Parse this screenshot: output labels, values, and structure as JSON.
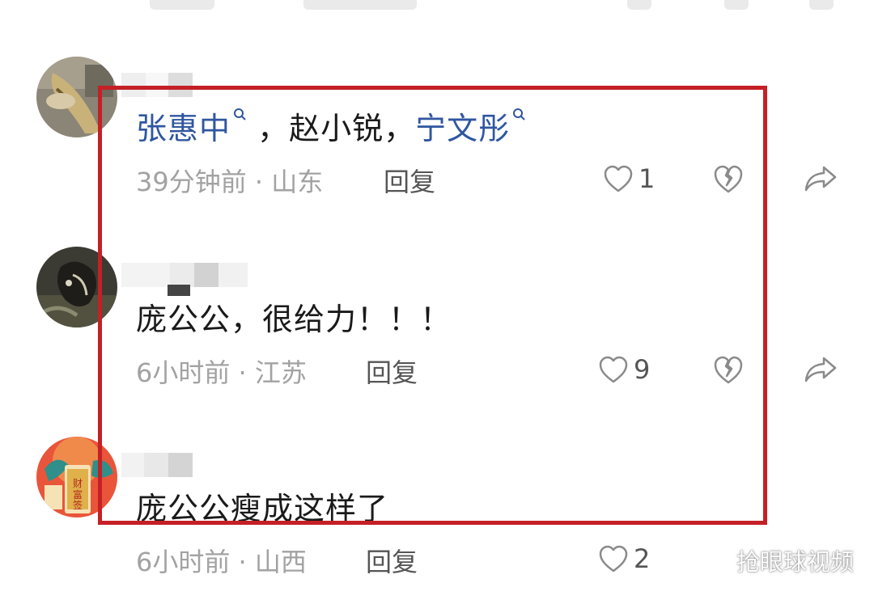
{
  "comments": [
    {
      "segments": [
        {
          "text": "张惠中",
          "type": "mention"
        },
        {
          "text": "，赵小锐，",
          "type": "plain"
        },
        {
          "text": "宁文彤",
          "type": "mention"
        }
      ],
      "meta": "39分钟前 · 山东",
      "reply_label": "回复",
      "likes": "1"
    },
    {
      "text": "庞公公，很给力！！！",
      "meta": "6小时前 · 江苏",
      "reply_label": "回复",
      "likes": "9"
    },
    {
      "text": "庞公公瘦成这样了",
      "meta": "6小时前 · 山西",
      "reply_label": "回复",
      "likes": "2"
    }
  ],
  "watermark": "抢眼球视频",
  "icons": {
    "mention": "search-icon",
    "like": "heart-outline-icon",
    "dislike": "broken-heart-icon",
    "share": "share-arrow-icon",
    "watermark": "wechat-icon"
  },
  "colors": {
    "mention": "#2f56a0",
    "meta": "#a2a2a2",
    "highlight_border": "#c42026"
  }
}
